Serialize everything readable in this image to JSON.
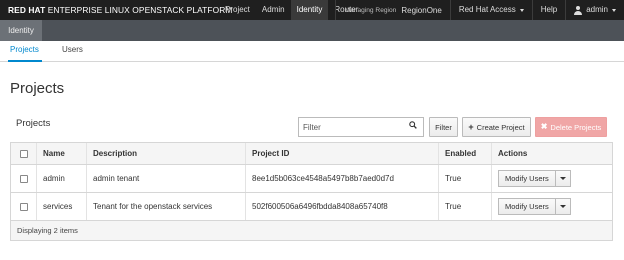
{
  "brand": {
    "strong": "RED HAT",
    "light": "ENTERPRISE LINUX OPENSTACK PLATFORM"
  },
  "topnav": [
    {
      "label": "Project",
      "active": false
    },
    {
      "label": "Admin",
      "active": false
    },
    {
      "label": "Identity",
      "active": true
    },
    {
      "label": "Router",
      "active": false
    }
  ],
  "region": {
    "label": "Managing Region",
    "value": "RegionOne"
  },
  "account_menu": "Red Hat Access",
  "help": "Help",
  "user": "admin",
  "dashboard": "Identity",
  "tabs": [
    {
      "label": "Projects",
      "active": true
    },
    {
      "label": "Users",
      "active": false
    }
  ],
  "page_title": "Projects",
  "table_title": "Projects",
  "filter": {
    "placeholder": "Filter",
    "button": "Filter"
  },
  "create_label": "Create Project",
  "delete_label": "Delete Projects",
  "table": {
    "headers": [
      "Name",
      "Description",
      "Project ID",
      "Enabled",
      "Actions"
    ],
    "rows": [
      {
        "name": "admin",
        "description": "admin tenant",
        "project_id": "8ee1d5b063ce4548a5497b8b7aed0d7d",
        "enabled": "True",
        "action": "Modify Users"
      },
      {
        "name": "services",
        "description": "Tenant for the openstack services",
        "project_id": "502f600506a6496fbdda8408a65740f8",
        "enabled": "True",
        "action": "Modify Users"
      }
    ],
    "footer": "Displaying 2 items"
  },
  "icons": {
    "search": "search-icon",
    "plus": "plus-icon",
    "delete": "x-icon",
    "user": "user-icon",
    "caret": "chevron-down-icon"
  },
  "colors": {
    "topbar": "#1f1f1f",
    "subbar": "#4d5258",
    "accent": "#0088ce",
    "danger": "#f0a6a6"
  }
}
